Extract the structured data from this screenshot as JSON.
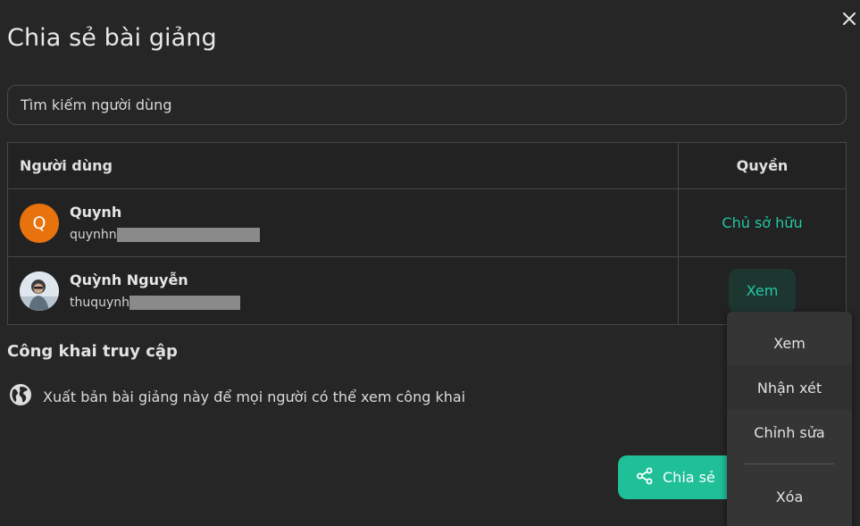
{
  "dialog": {
    "title": "Chia sẻ bài giảng",
    "close_icon": "close-icon"
  },
  "search": {
    "placeholder": "Tìm kiếm người dùng",
    "value": ""
  },
  "table": {
    "headers": {
      "user": "Người dùng",
      "role": "Quyền"
    },
    "rows": [
      {
        "avatar_letter": "Q",
        "avatar_color": "#e8720c",
        "name": "Quynh",
        "email_visible": "quynhn",
        "role": "Chủ sở hữu"
      },
      {
        "avatar_type": "photo",
        "name": "Quỳnh Nguyễn",
        "email_visible": "thuquynh",
        "role": "Xem"
      }
    ]
  },
  "public_access": {
    "title": "Công khai truy cập",
    "icon": "globe-icon",
    "label": "Xuất bản bài giảng này để mọi người có thể xem công khai"
  },
  "share_button": {
    "label": "Chia sẻ",
    "icon": "share-icon"
  },
  "role_menu": {
    "items": [
      "Xem",
      "Nhận xét",
      "Chỉnh sửa"
    ],
    "remove": "Xóa",
    "selected": "Xem"
  },
  "colors": {
    "background": "#262626",
    "accent": "#1fbf98",
    "accent_text": "#22c7a0",
    "avatar_orange": "#e8720c"
  }
}
